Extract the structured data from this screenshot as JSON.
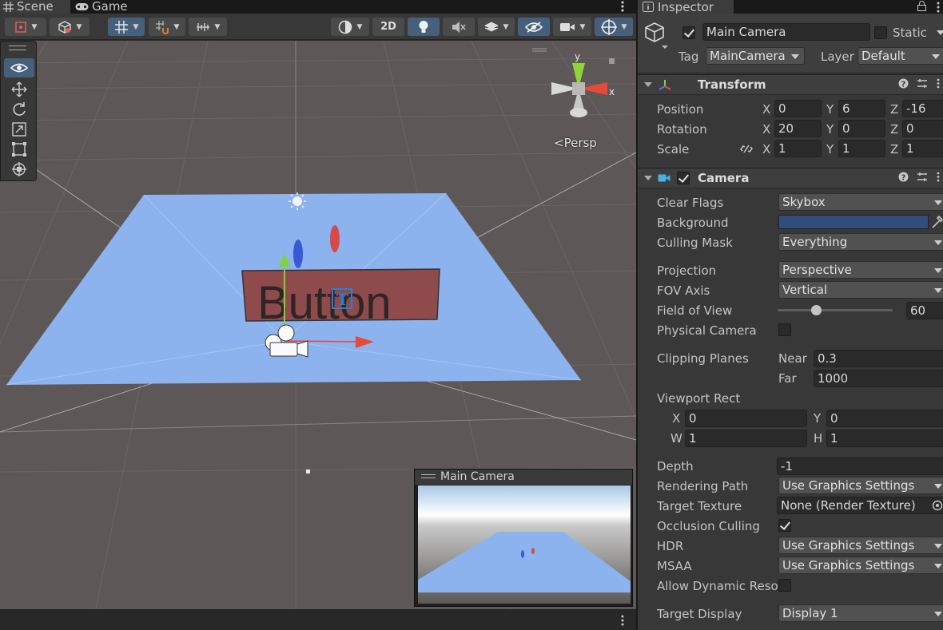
{
  "scene_panel": {
    "tabs": [
      {
        "label": "Scene",
        "icon": "grid-icon"
      },
      {
        "label": "Game",
        "icon": "gamepad-icon"
      }
    ],
    "toolbar": {
      "mode_2d": "2D"
    },
    "gizmo": {
      "y_label": "y",
      "x_label": "x",
      "projection_label": "Persp"
    },
    "scene_objects": {
      "ui_text": "Button"
    },
    "camera_preview": {
      "title": "Main Camera"
    }
  },
  "inspector": {
    "tab_label": "Inspector",
    "game_object": {
      "active": true,
      "name": "Main Camera",
      "static_label": "Static",
      "static": false,
      "tag_label": "Tag",
      "tag": "MainCamera",
      "layer_label": "Layer",
      "layer": "Default"
    },
    "transform": {
      "title": "Transform",
      "position_label": "Position",
      "rotation_label": "Rotation",
      "scale_label": "Scale",
      "axis_x": "X",
      "axis_y": "Y",
      "axis_z": "Z",
      "position": {
        "x": "0",
        "y": "6",
        "z": "-16"
      },
      "rotation": {
        "x": "20",
        "y": "0",
        "z": "0"
      },
      "scale": {
        "x": "1",
        "y": "1",
        "z": "1"
      }
    },
    "camera": {
      "title": "Camera",
      "enabled": true,
      "clear_flags_label": "Clear Flags",
      "clear_flags": "Skybox",
      "background_label": "Background",
      "background_color": "#314d79",
      "culling_mask_label": "Culling Mask",
      "culling_mask": "Everything",
      "projection_label": "Projection",
      "projection": "Perspective",
      "fov_axis_label": "FOV Axis",
      "fov_axis": "Vertical",
      "fov_label": "Field of View",
      "fov": "60",
      "fov_slider_fraction": 0.33,
      "physical_camera_label": "Physical Camera",
      "physical_camera": false,
      "clipping_label": "Clipping Planes",
      "near_label": "Near",
      "near": "0.3",
      "far_label": "Far",
      "far": "1000",
      "viewport_label": "Viewport Rect",
      "viewport": {
        "x_label": "X",
        "x": "0",
        "y_label": "Y",
        "y": "0",
        "w_label": "W",
        "w": "1",
        "h_label": "H",
        "h": "1"
      },
      "depth_label": "Depth",
      "depth": "-1",
      "rendering_path_label": "Rendering Path",
      "rendering_path": "Use Graphics Settings",
      "target_texture_label": "Target Texture",
      "target_texture": "None (Render Texture)",
      "occlusion_label": "Occlusion Culling",
      "occlusion": true,
      "hdr_label": "HDR",
      "hdr": "Use Graphics Settings",
      "msaa_label": "MSAA",
      "msaa": "Use Graphics Settings",
      "dynamic_res_label": "Allow Dynamic Reso",
      "dynamic_res": false,
      "target_display_label": "Target Display",
      "target_display": "Display 1"
    }
  }
}
